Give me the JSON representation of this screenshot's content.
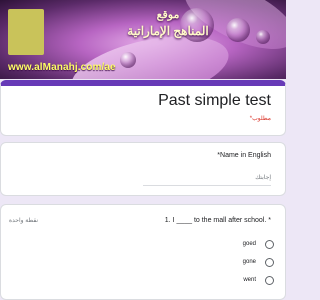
{
  "header": {
    "site_name_line1": "موقع",
    "site_name_line2": "المناهج الإماراتية",
    "site_url": "www.alManahj.com/ae"
  },
  "form": {
    "title": "Past simple test",
    "required_note": "*مطلوب"
  },
  "question1": {
    "label": "*Name in English",
    "placeholder": "إجابتك"
  },
  "question2": {
    "label": "1. I ____ to the mall after school. *",
    "points": "نقطة واحدة",
    "options": [
      "goed",
      "gone",
      "went"
    ]
  },
  "colors": {
    "accent": "#673ab7",
    "page_bg": "#ede7f6",
    "required_red": "#d93025",
    "logo_yellow": "#c9c35a"
  }
}
